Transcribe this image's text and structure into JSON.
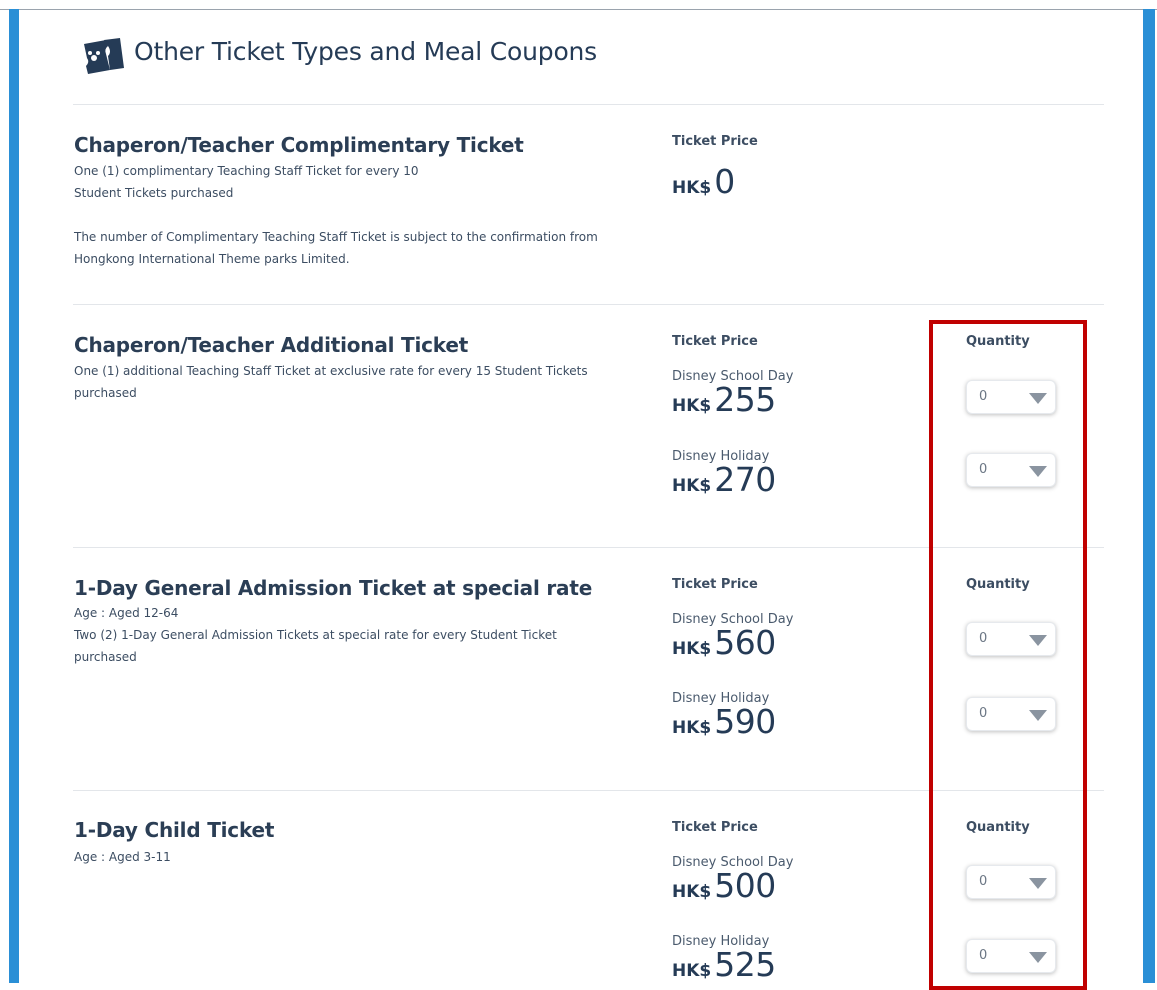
{
  "header": {
    "title": "Other Ticket Types and Meal Coupons",
    "icon": "mickey-ticket-icon"
  },
  "labels": {
    "ticket_price": "Ticket Price",
    "quantity": "Quantity"
  },
  "colors": {
    "accent_bar": "#2a8fd6",
    "highlight_border": "#c00000",
    "text": "#253b56"
  },
  "sections": [
    {
      "title": "Chaperon/Teacher Complimentary Ticket",
      "desc_lines": [
        "One (1) complimentary Teaching Staff Ticket for every 10",
        "Student Tickets purchased",
        "",
        "The number of Complimentary Teaching Staff Ticket is subject to the confirmation from",
        "Hongkong International Theme parks Limited."
      ],
      "prices": [
        {
          "currency": "HK$",
          "amount": "0"
        }
      ]
    },
    {
      "title": "Chaperon/Teacher Additional Ticket",
      "desc_lines": [
        "One (1) additional Teaching Staff Ticket at exclusive rate for every 15 Student Tickets",
        "purchased"
      ],
      "prices": [
        {
          "label": "Disney School Day",
          "currency": "HK$",
          "amount": "255",
          "quantity": "0"
        },
        {
          "label": "Disney Holiday",
          "currency": "HK$",
          "amount": "270",
          "quantity": "0"
        }
      ]
    },
    {
      "title": "1-Day General Admission Ticket at special rate",
      "desc_lines": [
        "Age : Aged 12-64",
        "Two (2) 1-Day General Admission Tickets at special rate for every Student Ticket",
        "purchased"
      ],
      "prices": [
        {
          "label": "Disney School Day",
          "currency": "HK$",
          "amount": "560",
          "quantity": "0"
        },
        {
          "label": "Disney Holiday",
          "currency": "HK$",
          "amount": "590",
          "quantity": "0"
        }
      ]
    },
    {
      "title": "1-Day Child Ticket",
      "desc_lines": [
        "Age : Aged 3-11"
      ],
      "prices": [
        {
          "label": "Disney School Day",
          "currency": "HK$",
          "amount": "500",
          "quantity": "0"
        },
        {
          "label": "Disney Holiday",
          "currency": "HK$",
          "amount": "525",
          "quantity": "0"
        }
      ]
    }
  ]
}
